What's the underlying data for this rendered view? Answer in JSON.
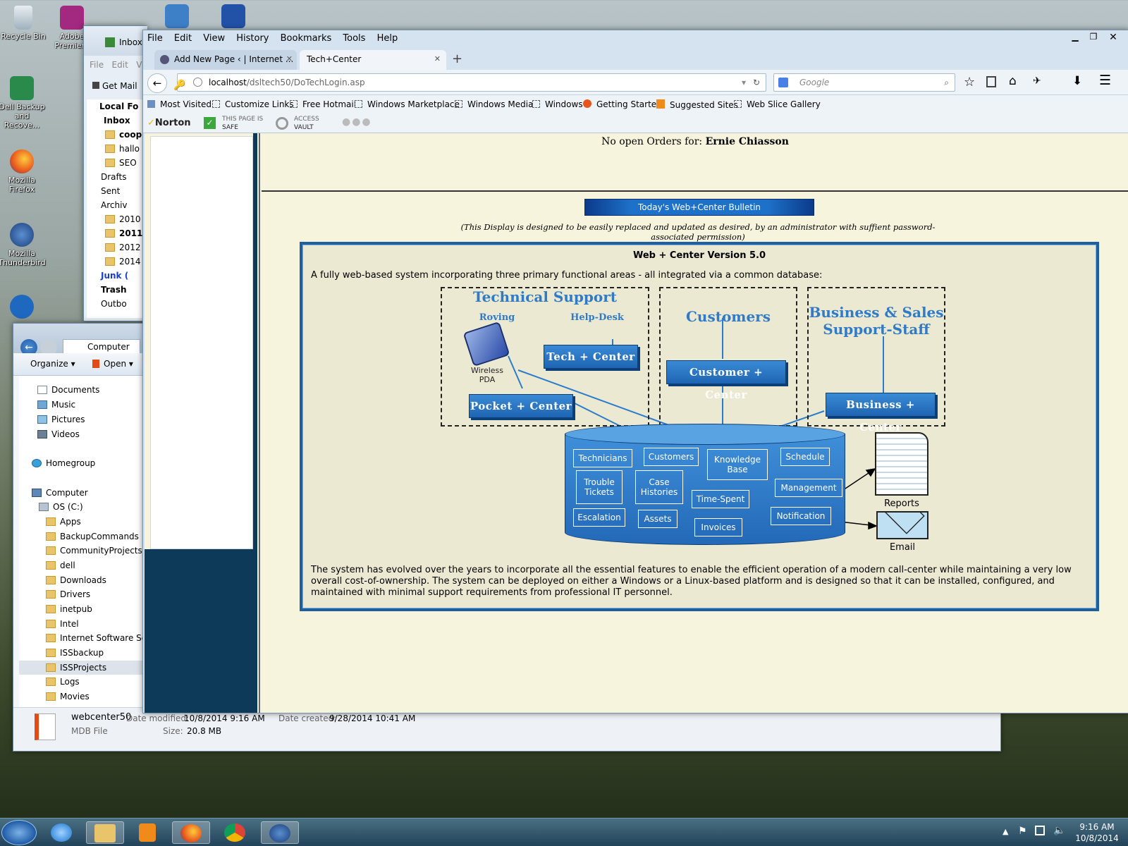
{
  "desktop": {
    "icons": [
      {
        "label": "Recycle Bin"
      },
      {
        "label": "Adobe Premiere"
      },
      {
        "label": "Dell Backup and Recove..."
      },
      {
        "label": "Mozilla Firefox"
      },
      {
        "label": "Mozilla Thunderbird"
      }
    ]
  },
  "thunderbird": {
    "title": "Inbox",
    "menu": [
      "File",
      "Edit",
      "V"
    ],
    "get_mail": "Get Mail",
    "folders": [
      "Local Fo",
      "Inbox",
      "coop",
      "hallo",
      "SEO",
      "Drafts",
      "Sent",
      "Archiv",
      "2010",
      "2011",
      "2012",
      "2014",
      "Junk (",
      "Trash",
      "Outbo"
    ]
  },
  "explorer": {
    "breadcrumb": "Computer",
    "toolbar": {
      "organize": "Organize",
      "open": "Open"
    },
    "tree": [
      "Documents",
      "Music",
      "Pictures",
      "Videos",
      "Homegroup",
      "Computer",
      "OS (C:)",
      "Apps",
      "BackupCommands",
      "CommunityProjects",
      "dell",
      "Downloads",
      "Drivers",
      "inetpub",
      "Intel",
      "Internet Software Scie",
      "ISSbackup",
      "ISSProjects",
      "Logs",
      "Movies"
    ],
    "status": {
      "filename": "webcenter50",
      "modified_label": "Date modified:",
      "modified_value": "10/8/2014 9:16 AM",
      "created_label": "Date created:",
      "created_value": "9/28/2014 10:41 AM",
      "type": "MDB File",
      "size_label": "Size:",
      "size_value": "20.8 MB"
    }
  },
  "firefox": {
    "menu": [
      "File",
      "Edit",
      "View",
      "History",
      "Bookmarks",
      "Tools",
      "Help"
    ],
    "tabs": [
      {
        "label": "Add New Page ‹ | Internet ..."
      },
      {
        "label": "Tech+Center"
      }
    ],
    "url_host": "localhost",
    "url_path": "/dsltech50/DoTechLogin.asp",
    "search_placeholder": "Google",
    "bookmarks": [
      "Most Visited",
      "Customize Links",
      "Free Hotmail",
      "Windows Marketplace",
      "Windows Media",
      "Windows",
      "Getting Started",
      "Suggested Sites",
      "Web Slice Gallery"
    ],
    "norton": {
      "brand": "Norton",
      "safe_line1": "THIS PAGE IS",
      "safe_line2": "SAFE",
      "vault_line1": "ACCESS",
      "vault_line2": "VAULT"
    }
  },
  "page": {
    "orders_prefix": "No open Orders for:",
    "orders_name": "Ernie Chiasson",
    "bulletin_button": "Today's Web+Center Bulletin",
    "bulletin_note": "(This Display is designed to be easily replaced and updated as desired, by an administrator with suffient password-associated permission)",
    "panel_title": "Web + Center Version 5.0",
    "intro": "A fully web-based system incorporating three primary functional areas - all integrated via a common database:",
    "footer": "The system has evolved over the years to incorporate all the essential features to enable the efficient operation of a modern call-center while maintaining a very low overall cost-of-ownership. The system can be deployed on either a Windows or a Linux-based platform and is designed so that it can be installed, configured, and maintained with minimal support requirements from professional IT personnel."
  },
  "diagram": {
    "tech_support": "Technical Support",
    "roving": "Roving",
    "helpdesk": "Help-Desk",
    "wireless_pda": [
      "Wireless",
      "PDA"
    ],
    "tech_center": "Tech + Center",
    "pocket_center": "Pocket + Center",
    "customers": "Customers",
    "customer_center": "Customer + Center",
    "biz_line1": "Business & Sales",
    "biz_line2": "Support-Staff",
    "business_center": "Business + Center",
    "db_cells": [
      "Technicians",
      "Customers",
      "Knowledge Base",
      "Schedule",
      "Trouble Tickets",
      "Case Histories",
      "Time-Spent",
      "Management",
      "Escalation",
      "Assets",
      "Invoices",
      "Notification"
    ],
    "reports": "Reports",
    "email": "Email"
  },
  "clock": {
    "time": "9:16 AM",
    "date": "10/8/2014"
  }
}
